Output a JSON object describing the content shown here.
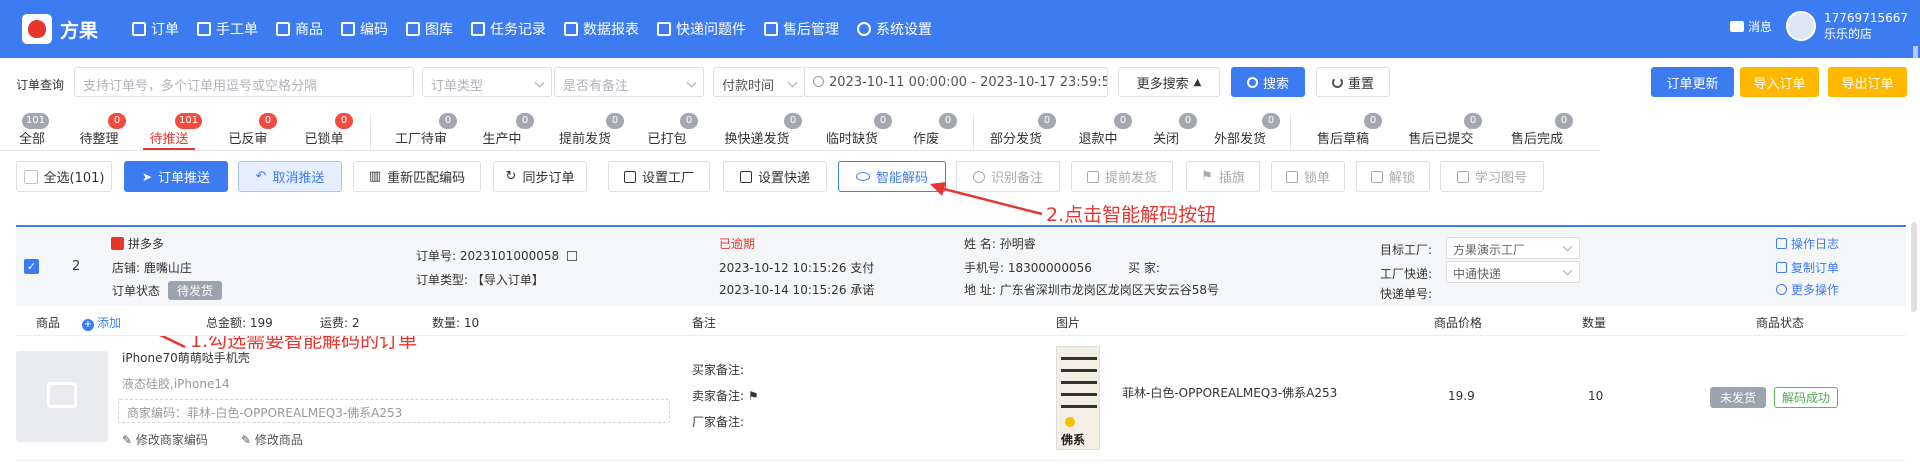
{
  "app": {
    "name": "方果"
  },
  "nav": [
    {
      "label": "订单",
      "icon": "order-icon"
    },
    {
      "label": "手工单",
      "icon": "list-icon"
    },
    {
      "label": "商品",
      "icon": "goods-icon"
    },
    {
      "label": "编码",
      "icon": "barcode-icon"
    },
    {
      "label": "图库",
      "icon": "image-icon"
    },
    {
      "label": "任务记录",
      "icon": "task-icon"
    },
    {
      "label": "数据报表",
      "icon": "chart-icon"
    },
    {
      "label": "快递问题件",
      "icon": "express-icon"
    },
    {
      "label": "售后管理",
      "icon": "aftersale-icon"
    },
    {
      "label": "系统设置",
      "icon": "gear-icon"
    }
  ],
  "user": {
    "msg_label": "消息",
    "phone": "17769715667",
    "shop": "乐乐的店"
  },
  "search": {
    "label": "订单查询",
    "order_placeholder": "支持订单号，多个订单用逗号或空格分隔",
    "order_type_placeholder": "订单类型",
    "remark_placeholder": "是否有备注",
    "time_type": "付款时间",
    "date_start": "2023-10-11 00:00:00",
    "date_sep": "-",
    "date_end": "2023-10-17 23:59:59",
    "more": "更多搜索",
    "search_btn": "搜索",
    "reset_btn": "重置",
    "update_btn": "订单更新",
    "import_btn": "导入订单",
    "export_btn": "导出订单"
  },
  "tabs": [
    {
      "label": "全部",
      "badge": "101"
    },
    {
      "label": "待整理",
      "badge": "0"
    },
    {
      "label": "待推送",
      "badge": "101"
    },
    {
      "label": "已反审",
      "badge": "0"
    },
    {
      "label": "已锁单",
      "badge": "0"
    },
    {
      "label": "工厂待审",
      "badge": "0"
    },
    {
      "label": "生产中",
      "badge": "0"
    },
    {
      "label": "提前发货",
      "badge": "0"
    },
    {
      "label": "已打包",
      "badge": "0"
    },
    {
      "label": "换快递发货",
      "badge": "0"
    },
    {
      "label": "临时缺货",
      "badge": "0"
    },
    {
      "label": "作废",
      "badge": "0"
    },
    {
      "label": "部分发货",
      "badge": "0"
    },
    {
      "label": "退款中",
      "badge": "0"
    },
    {
      "label": "关闭",
      "badge": "0"
    },
    {
      "label": "外部发货",
      "badge": "0"
    },
    {
      "label": "售后草稿",
      "badge": "0"
    },
    {
      "label": "售后已提交",
      "badge": "0"
    },
    {
      "label": "售后完成",
      "badge": "0"
    }
  ],
  "toolbar": {
    "select_all": "全选(101)",
    "push": "订单推送",
    "cancel_push": "取消推送",
    "rematch": "重新匹配编码",
    "sync": "同步订单",
    "set_factory": "设置工厂",
    "set_express": "设置快递",
    "smart_decode": "智能解码",
    "recognize_remark": "识别备注",
    "early_ship": "提前发货",
    "flag": "插旗",
    "lock": "锁单",
    "unlock": "解锁",
    "learn": "学习图号"
  },
  "annotations": {
    "step1": "1.勾选需要智能解码的订单",
    "step2": "2.点击智能解码按钮"
  },
  "order": {
    "index": "2",
    "platform": "拼多多",
    "shop_label": "店铺:",
    "shop": "鹿嘴山庄",
    "status_label": "订单状态",
    "status": "待发货",
    "order_no_label": "订单号:",
    "order_no": "2023101000058",
    "order_type_label": "订单类型:",
    "order_type": "【导入订单】",
    "overdue": "已逾期",
    "pay_time": "2023-10-12 10:15:26 支付",
    "promise_time": "2023-10-14 10:15:26 承诺",
    "name_label": "姓 名:",
    "name": "孙明睿",
    "phone_label": "手机号:",
    "phone": "18300000056",
    "buyer_label": "买 家:",
    "address_label": "地 址:",
    "address": "广东省深圳市龙岗区龙岗区天安云谷58号",
    "factory_label": "目标工厂:",
    "factory": "方果演示工厂",
    "express_label": "工厂快递:",
    "express": "中通快递",
    "tracking_label": "快递单号:",
    "log": "操作日志",
    "copy": "复制订单",
    "more": "更多操作"
  },
  "columns": {
    "product": "商品",
    "add": "添加",
    "total": "总金额:  199",
    "freight": "运费:  2",
    "qty": "数量:  10",
    "remark": "备注",
    "image": "图片",
    "price": "商品价格",
    "count": "数量",
    "status": "商品状态"
  },
  "product": {
    "name": "iPhone70萌萌哒手机壳",
    "spec": "液态硅胶,iPhone14",
    "code": "商家编码：菲林-白色-OPPOREALMEQ3-佛系A253",
    "edit_code": "修改商家编码",
    "edit_goods": "修改商品",
    "buyer_remark": "买家备注:",
    "seller_remark": "卖家备注:",
    "factory_remark": "厂家备注:",
    "image_code": "菲林-白色-OPPOREALMEQ3-佛系A253",
    "image_text": "佛系",
    "price": "19.9",
    "qty": "10",
    "ship_status": "未发货",
    "decode_status": "解码成功"
  }
}
